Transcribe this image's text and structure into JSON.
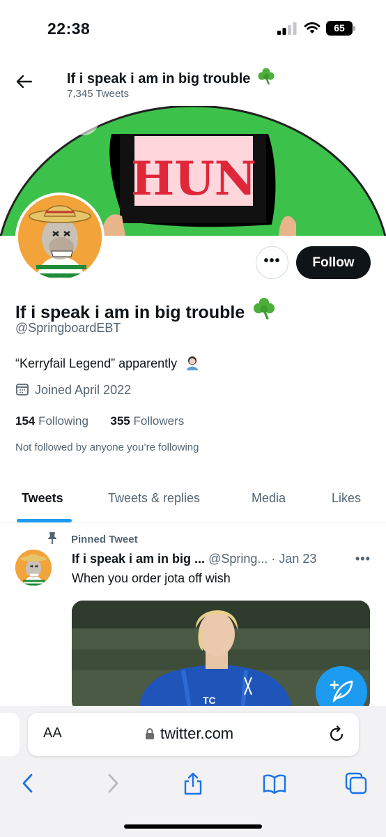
{
  "status_bar": {
    "time": "22:38",
    "battery": "65"
  },
  "header": {
    "title": "If i speak i am in big trouble",
    "tweet_count": "7,345 Tweets"
  },
  "banner": {
    "sign_text": "HUN"
  },
  "actions": {
    "more_label": "•••",
    "follow_label": "Follow"
  },
  "profile": {
    "name": "If i speak i am in big trouble",
    "handle": "@SpringboardEBT",
    "bio": "“Kerryfail Legend” apparently",
    "joined": "Joined April 2022",
    "following_count": "154",
    "following_label": "Following",
    "followers_count": "355",
    "followers_label": "Followers",
    "not_followed": "Not followed by anyone you’re following"
  },
  "tabs": [
    {
      "label": "Tweets",
      "active": true
    },
    {
      "label": "Tweets & replies",
      "active": false
    },
    {
      "label": "Media",
      "active": false
    },
    {
      "label": "Likes",
      "active": false
    }
  ],
  "pinned_tweet": {
    "pinned_label": "Pinned Tweet",
    "author": "If i speak i am in big ...",
    "handle": "@Spring...",
    "date": "· Jan 23",
    "more": "•••",
    "text": "When you order jota off wish",
    "shirt_text": "TC"
  },
  "browser": {
    "aa_label": "AA",
    "url": "twitter.com"
  },
  "colors": {
    "accent": "#1d9bf0",
    "banner_green": "#3cc24a",
    "sign_text": "#e0273a",
    "avatar_bg": "#f2a33a"
  }
}
